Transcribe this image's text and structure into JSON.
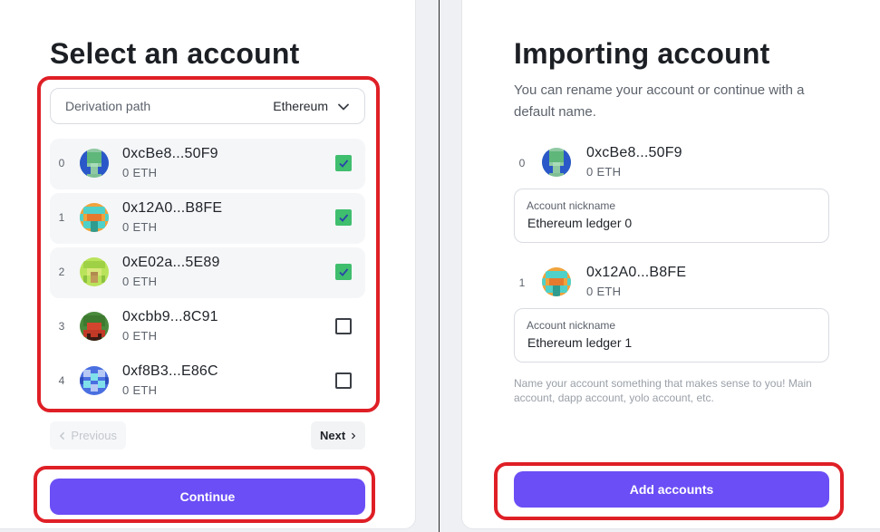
{
  "left": {
    "title": "Select an account",
    "derivation": {
      "label": "Derivation path",
      "value": "Ethereum"
    },
    "accounts": [
      {
        "index": "0",
        "address": "0xcBe8...50F9",
        "balance": "0 ETH",
        "checked": true
      },
      {
        "index": "1",
        "address": "0x12A0...B8FE",
        "balance": "0 ETH",
        "checked": true
      },
      {
        "index": "2",
        "address": "0xE02a...5E89",
        "balance": "0 ETH",
        "checked": true
      },
      {
        "index": "3",
        "address": "0xcbb9...8C91",
        "balance": "0 ETH",
        "checked": false
      },
      {
        "index": "4",
        "address": "0xf8B3...E86C",
        "balance": "0 ETH",
        "checked": false
      }
    ],
    "pagination": {
      "previous": "Previous",
      "next": "Next"
    },
    "continue": "Continue"
  },
  "right": {
    "title": "Importing account",
    "subtitle": "You can rename your account or continue with a default name.",
    "imports": [
      {
        "index": "0",
        "address": "0xcBe8...50F9",
        "balance": "0 ETH",
        "nickname_label": "Account nickname",
        "nickname": "Ethereum ledger 0"
      },
      {
        "index": "1",
        "address": "0x12A0...B8FE",
        "balance": "0 ETH",
        "nickname_label": "Account nickname",
        "nickname": "Ethereum ledger 1"
      }
    ],
    "hint": "Name your account something that makes sense to you! Main account, dapp account, yolo account, etc.",
    "add": "Add accounts"
  },
  "colors": {
    "accent": "#6b4ef5",
    "check": "#3fbe6e",
    "highlight": "#df1f26"
  }
}
